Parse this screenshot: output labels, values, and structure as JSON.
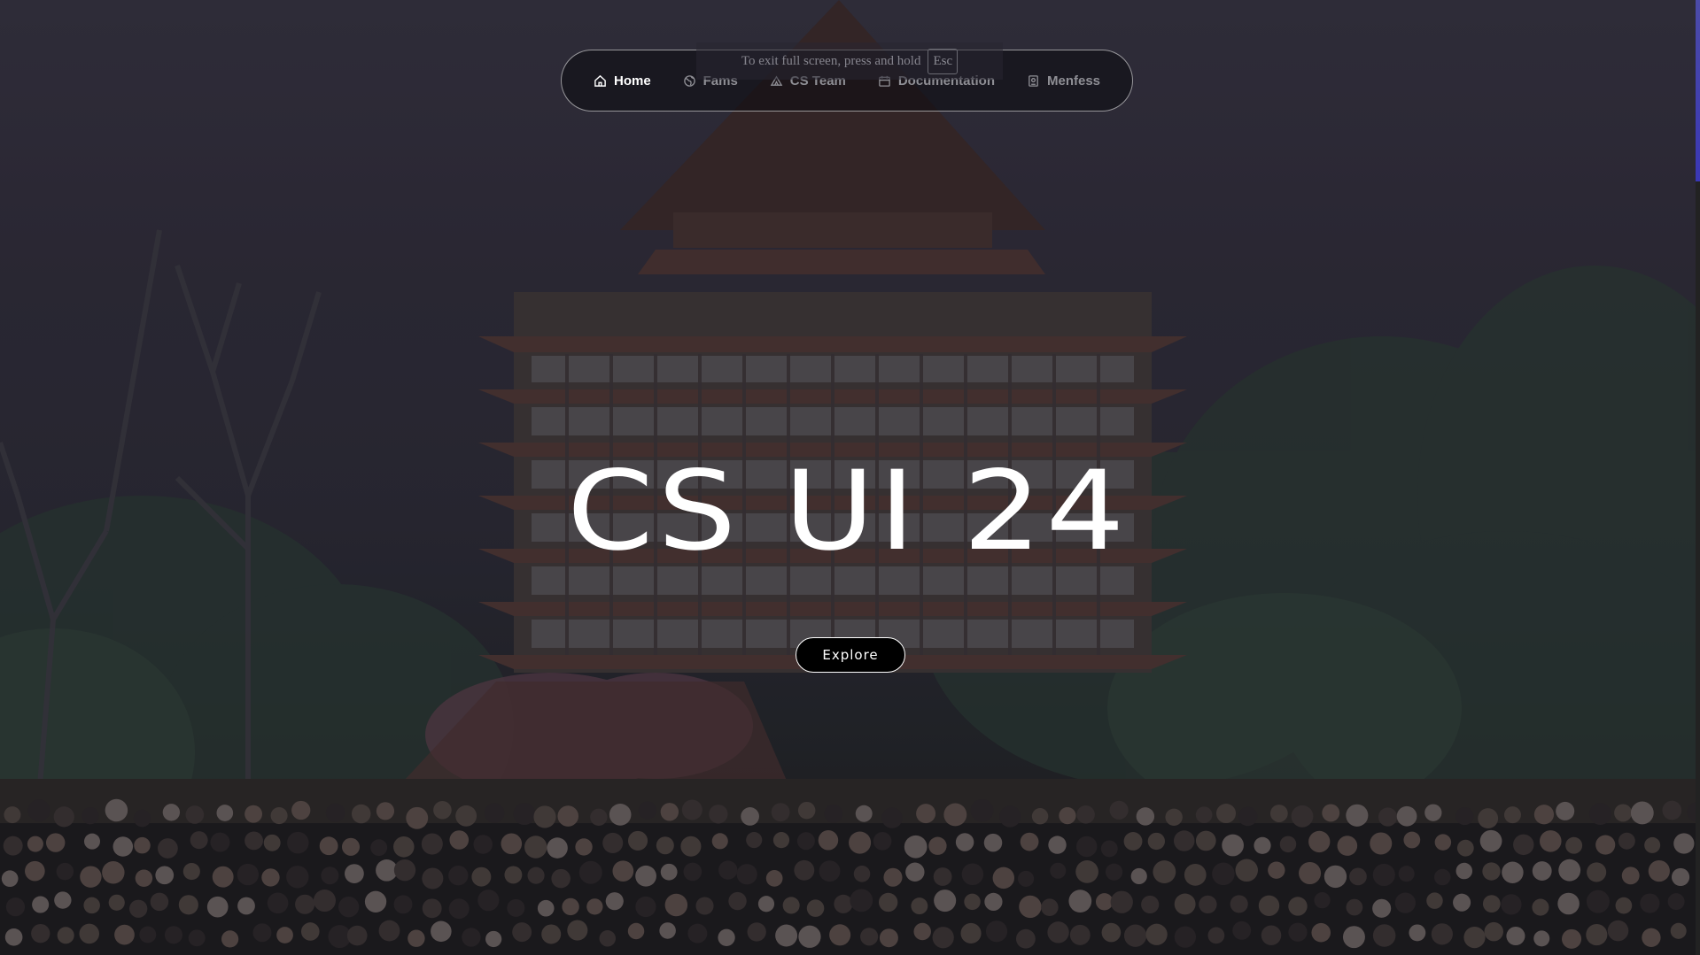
{
  "navbar": {
    "items": [
      {
        "label": "Home",
        "icon": "home-icon",
        "active": true
      },
      {
        "label": "Fams",
        "icon": "globe-icon",
        "active": false
      },
      {
        "label": "CS Team",
        "icon": "tent-icon",
        "active": false
      },
      {
        "label": "Documentation",
        "icon": "calendar-icon",
        "active": false
      },
      {
        "label": "Menfess",
        "icon": "mailbox-icon",
        "active": false
      }
    ]
  },
  "fullscreen_notice": {
    "text": "To exit full screen, press and hold",
    "key": "Esc"
  },
  "hero": {
    "title": "CS UI 24",
    "button_label": "Explore"
  },
  "colors": {
    "nav_active": "#ffffff",
    "nav_inactive": "#8f8f95",
    "scrollbar_thumb": "#3a37b5"
  }
}
